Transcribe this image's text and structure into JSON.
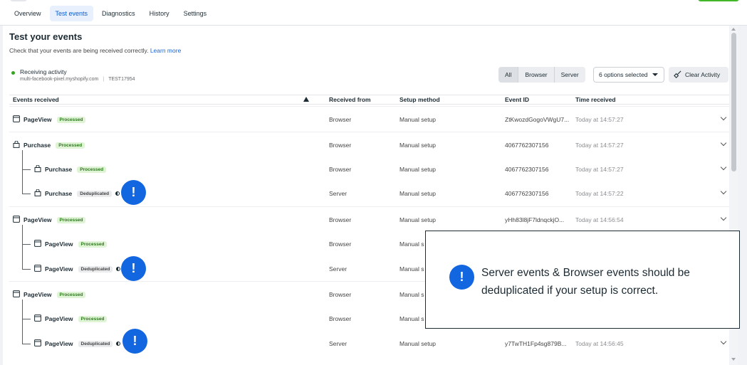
{
  "tabs": [
    {
      "label": "Overview",
      "active": false
    },
    {
      "label": "Test events",
      "active": true
    },
    {
      "label": "Diagnostics",
      "active": false
    },
    {
      "label": "History",
      "active": false
    },
    {
      "label": "Settings",
      "active": false
    }
  ],
  "header": {
    "title": "Test your events",
    "subtitle": "Check that your events are being received correctly.",
    "learn_more": "Learn more"
  },
  "status": {
    "label": "Receiving activity",
    "domain": "multi-facebook-pixel.myshopify.com",
    "separator": "|",
    "code": "TEST17954"
  },
  "filters": {
    "all": "All",
    "browser": "Browser",
    "server": "Server",
    "options_selected": "6 options selected",
    "clear_activity": "Clear Activity"
  },
  "columns": {
    "events_received": "Events received",
    "received_from": "Received from",
    "setup_method": "Setup method",
    "event_id": "Event ID",
    "time_received": "Time received"
  },
  "rows": [
    {
      "name": "PageView",
      "icon": "browser-window-icon",
      "badge": "Processed",
      "from": "Browser",
      "method": "Manual setup",
      "event_id": "ZtKwozdGogoVWgU7...",
      "time": "Today at 14:57:27"
    },
    {
      "name": "Purchase",
      "icon": "shopping-bag-icon",
      "badge": "Processed",
      "from": "Browser",
      "method": "Manual setup",
      "event_id": "4067762307156",
      "time": "Today at 14:57:27"
    },
    {
      "name": "Purchase",
      "icon": "shopping-bag-icon",
      "badge": "Processed",
      "from": "Browser",
      "method": "Manual setup",
      "event_id": "4067762307156",
      "time": "Today at 14:57:27"
    },
    {
      "name": "Purchase",
      "icon": "shopping-bag-icon",
      "badge": "Deduplicated",
      "from": "Server",
      "method": "Manual setup",
      "event_id": "4067762307156",
      "time": "Today at 14:57:22"
    },
    {
      "name": "PageView",
      "icon": "browser-window-icon",
      "badge": "Processed",
      "from": "Browser",
      "method": "Manual setup",
      "event_id": "yHh83l8jF7ldnqckjO...",
      "time": "Today at 14:56:54"
    },
    {
      "name": "PageView",
      "icon": "browser-window-icon",
      "badge": "Processed",
      "from": "Browser",
      "method": "Manual s",
      "event_id": "",
      "time": ""
    },
    {
      "name": "PageView",
      "icon": "browser-window-icon",
      "badge": "Deduplicated",
      "from": "Server",
      "method": "Manual s",
      "event_id": "",
      "time": ""
    },
    {
      "name": "PageView",
      "icon": "browser-window-icon",
      "badge": "Processed",
      "from": "Browser",
      "method": "Manual s",
      "event_id": "",
      "time": ""
    },
    {
      "name": "PageView",
      "icon": "browser-window-icon",
      "badge": "Processed",
      "from": "Browser",
      "method": "Manual s",
      "event_id": "",
      "time": ""
    },
    {
      "name": "PageView",
      "icon": "browser-window-icon",
      "badge": "Deduplicated",
      "from": "Server",
      "method": "Manual setup",
      "event_id": "y7TwTH1Fp4sg879B...",
      "time": "Today at 14:56:45"
    }
  ],
  "alert_symbol": "!",
  "callout": {
    "message": "Server events & Browser events should be deduplicated if your setup is correct."
  },
  "colors": {
    "accent": "#1266e0",
    "processed": "#dff3d5",
    "status_green": "#36a420"
  }
}
